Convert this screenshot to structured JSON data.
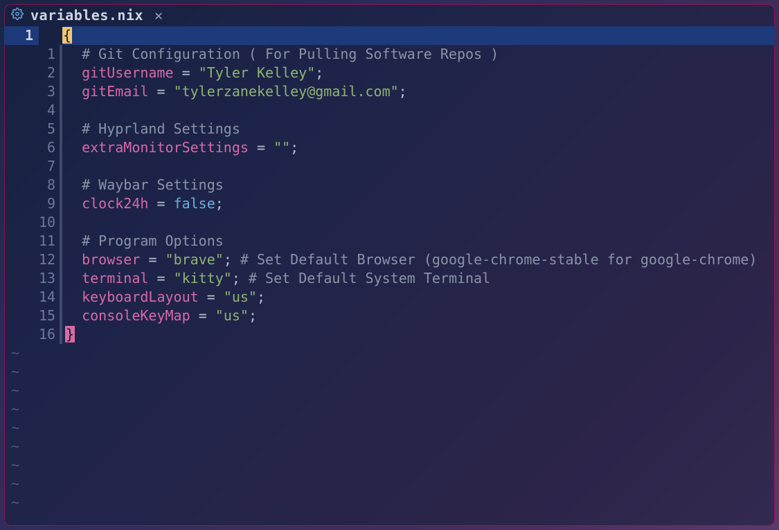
{
  "tab": {
    "icon_name": "gear-icon",
    "filename": "variables.nix",
    "close_glyph": "✕"
  },
  "outer_line_number": "1",
  "tilde_count": 9,
  "lines": [
    {
      "n": "",
      "tokens": [
        {
          "t": "brace",
          "v": "{"
        }
      ]
    },
    {
      "n": "1",
      "tokens": [
        {
          "t": "indent"
        },
        {
          "t": "comment",
          "v": "# Git Configuration ( For Pulling Software Repos )"
        }
      ]
    },
    {
      "n": "2",
      "tokens": [
        {
          "t": "indent"
        },
        {
          "t": "key",
          "v": "gitUsername"
        },
        {
          "t": "sp"
        },
        {
          "t": "eq",
          "v": "="
        },
        {
          "t": "sp"
        },
        {
          "t": "str",
          "v": "\"Tyler Kelley\""
        },
        {
          "t": "semi",
          "v": ";"
        }
      ]
    },
    {
      "n": "3",
      "tokens": [
        {
          "t": "indent"
        },
        {
          "t": "key",
          "v": "gitEmail"
        },
        {
          "t": "sp"
        },
        {
          "t": "eq",
          "v": "="
        },
        {
          "t": "sp"
        },
        {
          "t": "str",
          "v": "\"tylerzanekelley@gmail.com\""
        },
        {
          "t": "semi",
          "v": ";"
        }
      ]
    },
    {
      "n": "4",
      "tokens": []
    },
    {
      "n": "5",
      "tokens": [
        {
          "t": "indent"
        },
        {
          "t": "comment",
          "v": "# Hyprland Settings"
        }
      ]
    },
    {
      "n": "6",
      "tokens": [
        {
          "t": "indent"
        },
        {
          "t": "key",
          "v": "extraMonitorSettings"
        },
        {
          "t": "sp"
        },
        {
          "t": "eq",
          "v": "="
        },
        {
          "t": "sp"
        },
        {
          "t": "str",
          "v": "\"\""
        },
        {
          "t": "semi",
          "v": ";"
        }
      ]
    },
    {
      "n": "7",
      "tokens": []
    },
    {
      "n": "8",
      "tokens": [
        {
          "t": "indent"
        },
        {
          "t": "comment",
          "v": "# Waybar Settings"
        }
      ]
    },
    {
      "n": "9",
      "tokens": [
        {
          "t": "indent"
        },
        {
          "t": "key",
          "v": "clock24h"
        },
        {
          "t": "sp"
        },
        {
          "t": "eq",
          "v": "="
        },
        {
          "t": "sp"
        },
        {
          "t": "bool",
          "v": "false"
        },
        {
          "t": "semi",
          "v": ";"
        }
      ]
    },
    {
      "n": "10",
      "tokens": []
    },
    {
      "n": "11",
      "tokens": [
        {
          "t": "indent"
        },
        {
          "t": "comment",
          "v": "# Program Options"
        }
      ]
    },
    {
      "n": "12",
      "tokens": [
        {
          "t": "indent"
        },
        {
          "t": "key",
          "v": "browser"
        },
        {
          "t": "sp"
        },
        {
          "t": "eq",
          "v": "="
        },
        {
          "t": "sp"
        },
        {
          "t": "str",
          "v": "\"brave\""
        },
        {
          "t": "semi",
          "v": ";"
        },
        {
          "t": "sp"
        },
        {
          "t": "comment",
          "v": "# Set Default Browser (google-chrome-stable for google-chrome)"
        }
      ]
    },
    {
      "n": "13",
      "tokens": [
        {
          "t": "indent"
        },
        {
          "t": "key",
          "v": "terminal"
        },
        {
          "t": "sp"
        },
        {
          "t": "eq",
          "v": "="
        },
        {
          "t": "sp"
        },
        {
          "t": "str",
          "v": "\"kitty\""
        },
        {
          "t": "semi",
          "v": ";"
        },
        {
          "t": "sp"
        },
        {
          "t": "comment",
          "v": "# Set Default System Terminal"
        }
      ]
    },
    {
      "n": "14",
      "tokens": [
        {
          "t": "indent"
        },
        {
          "t": "key",
          "v": "keyboardLayout"
        },
        {
          "t": "sp"
        },
        {
          "t": "eq",
          "v": "="
        },
        {
          "t": "sp"
        },
        {
          "t": "str",
          "v": "\"us\""
        },
        {
          "t": "semi",
          "v": ";"
        }
      ]
    },
    {
      "n": "15",
      "tokens": [
        {
          "t": "indent"
        },
        {
          "t": "key",
          "v": "consoleKeyMap"
        },
        {
          "t": "sp"
        },
        {
          "t": "eq",
          "v": "="
        },
        {
          "t": "sp"
        },
        {
          "t": "str",
          "v": "\"us\""
        },
        {
          "t": "semi",
          "v": ";"
        }
      ]
    },
    {
      "n": "16",
      "tokens": [
        {
          "t": "brace2",
          "v": "}"
        }
      ]
    }
  ]
}
